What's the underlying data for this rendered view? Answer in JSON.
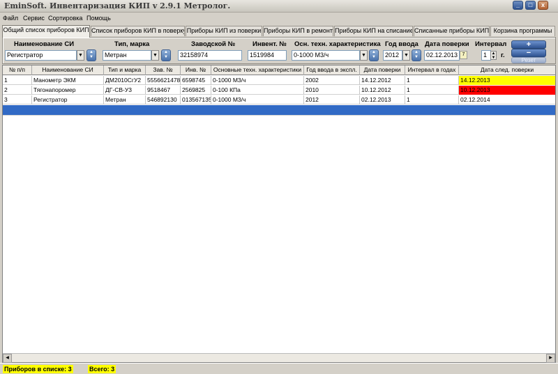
{
  "window": {
    "title": "EminSoft. Инвентаризация КИП v 2.9.1 Метролог.",
    "minimize": "_",
    "maximize": "□",
    "close": "x"
  },
  "menu": [
    "Файл",
    "Сервис",
    "Сортировка",
    "Помощь"
  ],
  "tabs": [
    "Общий список приборов КИП",
    "Список приборов КИП в поверку",
    "Приборы КИП из поверки",
    "Приборы КИП в ремонт",
    "Приборы КИП на списание",
    "Списанные приборы КИП",
    "Корзина программы"
  ],
  "filters": {
    "name_label": "Наименование СИ",
    "name_value": "Регистратор",
    "type_label": "Тип, марка",
    "type_value": "Метран",
    "serial_label": "Заводской №",
    "serial_value": "32158974",
    "inv_label": "Инвент. №",
    "inv_value": "1519984",
    "char_label": "Осн. техн. характеристика",
    "char_value": "0-1000 М3/ч",
    "year_label": "Год ввода",
    "year_value": "2012",
    "date_label": "Дата поверки",
    "date_value": "02.12.2013",
    "interval_label": "Интервал",
    "interval_value": "1",
    "interval_unit": "г.",
    "add_label": "+",
    "remove_label": "−",
    "reset_label": "Резет"
  },
  "table": {
    "headers": [
      "№ п/п",
      "Наименование СИ",
      "Тип и марка",
      "Зав. №",
      "Инв. №",
      "Основные техн. характеристики",
      "Год ввода в экспл.",
      "Дата поверки",
      "Интервал в годах",
      "Дата след. поверки"
    ],
    "rows": [
      [
        "1",
        "Манометр ЭКМ",
        "ДМ2010СгУ2",
        "5556621478",
        "6598745",
        "0-1000 М3/ч",
        "2002",
        "14.12.2012",
        "1",
        "14.12.2013"
      ],
      [
        "2",
        "Тягонапоромер",
        "ДГ-СВ-У3",
        "9518467",
        "2569825",
        "0-100 КПа",
        "2010",
        "10.12.2012",
        "1",
        "10.12.2013"
      ],
      [
        "3",
        "Регистратор",
        "Метран",
        "546892130",
        "013567135",
        "0-1000 М3/ч",
        "2012",
        "02.12.2013",
        "1",
        "02.12.2014"
      ]
    ],
    "status_colors": {
      "due_soon": "#ffff00",
      "overdue": "#ff0000",
      "selection": "#316ac5"
    }
  },
  "status": {
    "in_list": "Приборов в списке: 3",
    "total": "Всего: 3"
  }
}
